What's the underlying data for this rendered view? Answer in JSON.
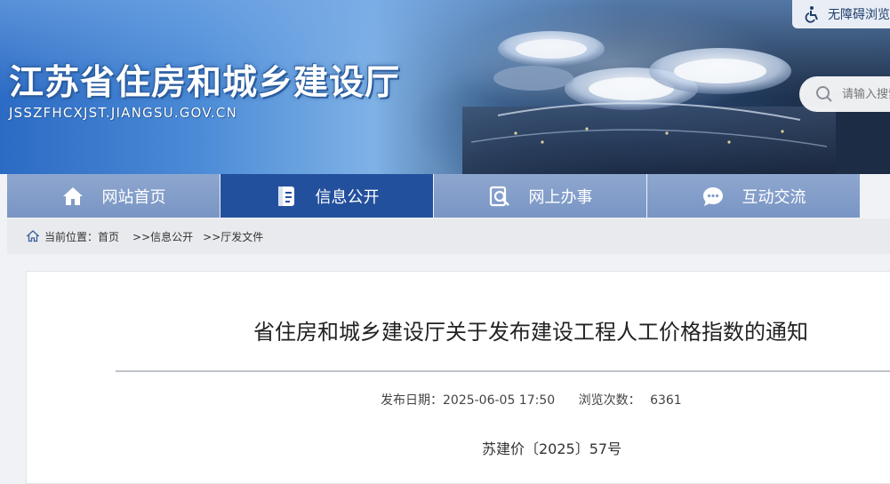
{
  "header": {
    "site_title": "江苏省住房和城乡建设厅",
    "site_domain": "JSSZFHCXJST.JIANGSU.GOV.CN",
    "accessibility_label": "无障碍浏览",
    "search_placeholder": "请输入搜索"
  },
  "nav": {
    "items": [
      {
        "label": "网站首页",
        "icon": "home-icon"
      },
      {
        "label": "信息公开",
        "icon": "document-icon"
      },
      {
        "label": "网上办事",
        "icon": "search-doc-icon"
      },
      {
        "label": "互动交流",
        "icon": "chat-icon"
      }
    ],
    "active_index": 1
  },
  "breadcrumb": {
    "prefix": "当前位置：",
    "items": [
      "首页",
      ">>信息公开",
      ">>厅发文件"
    ]
  },
  "article": {
    "title": "省住房和城乡建设厅关于发布建设工程人工价格指数的通知",
    "publish_label": "发布日期：",
    "publish_date": "2025-06-05 17:50",
    "views_label": "浏览次数：",
    "views": "6361",
    "doc_number": "苏建价〔2025〕57号"
  },
  "colors": {
    "nav_bg": "#7f9ac7",
    "nav_active": "#23509d",
    "crumb_bg": "#e8eaed",
    "page_bg": "#f0f2f5"
  }
}
